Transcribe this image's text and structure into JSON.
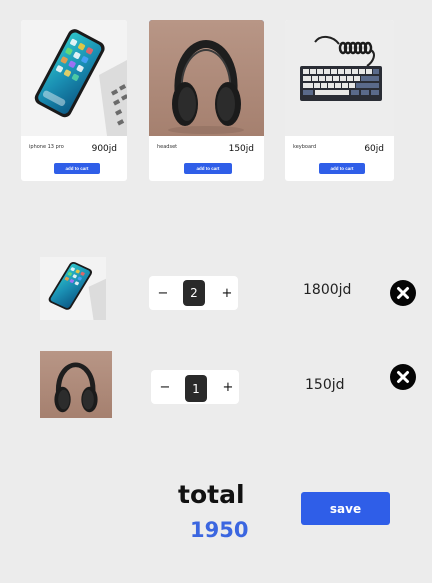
{
  "products": [
    {
      "name": "iphone 13 pro",
      "price": "900jd",
      "add_label": "add to cart",
      "image": "iphone-image"
    },
    {
      "name": "headset",
      "price": "150jd",
      "add_label": "add to cart",
      "image": "headphones-image"
    },
    {
      "name": "keyboard",
      "price": "60jd",
      "add_label": "add to cart",
      "image": "keyboard-image"
    }
  ],
  "cart": [
    {
      "image": "iphone-image",
      "minus": "−",
      "qty": "2",
      "plus": "+",
      "line_total": "1800jd",
      "remove_icon": "close-circle-icon"
    },
    {
      "image": "headphones-image",
      "minus": "−",
      "qty": "1",
      "plus": "+",
      "line_total": "150jd",
      "remove_icon": "close-circle-icon"
    }
  ],
  "summary": {
    "total_label": "total",
    "total_value": "1950",
    "save_label": "save"
  },
  "colors": {
    "background": "#ececec",
    "accent": "#2f5ee8",
    "total_value": "#3b66e0",
    "selected_border": "#3d7ddc"
  }
}
